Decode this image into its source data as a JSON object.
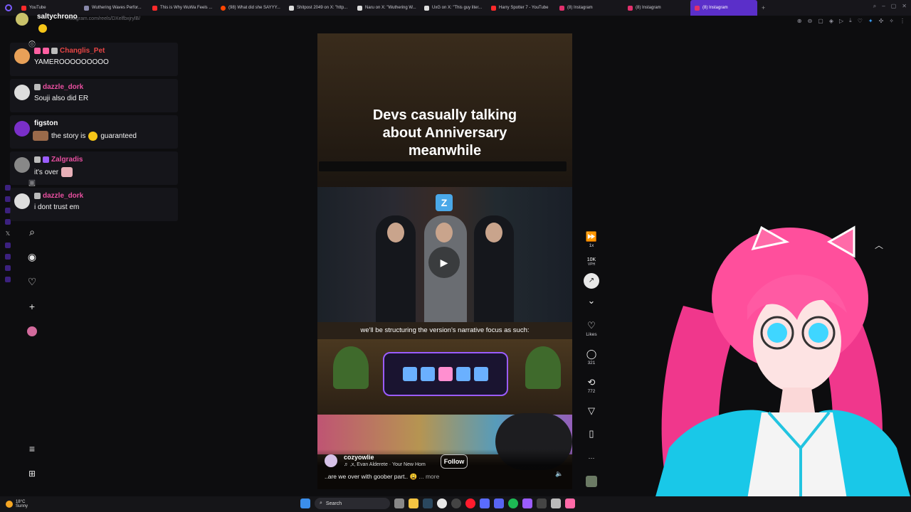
{
  "browser": {
    "tabs": [
      {
        "label": "YouTube",
        "color": "#ff2a2a",
        "active": false
      },
      {
        "label": "Wuthering Waves Perfor...",
        "color": "#8888aa",
        "active": false
      },
      {
        "label": "This is Why WuWa Feels ...",
        "color": "#ff2a2a",
        "active": false
      },
      {
        "label": "(98) What did she SAYYY...",
        "color": "#ff4500",
        "active": false
      },
      {
        "label": "Shitpost 2049 on X: \"http...",
        "color": "#dddddd",
        "active": false
      },
      {
        "label": "Naru on X: \"Wuthering W...",
        "color": "#dddddd",
        "active": false
      },
      {
        "label": "UxG on X: \"This guy liter...",
        "color": "#dddddd",
        "active": false
      },
      {
        "label": "Harry Spotter 7 - YouTube",
        "color": "#ff2a2a",
        "active": false
      },
      {
        "label": "(8) Instagram",
        "color": "#e1306c",
        "active": false
      },
      {
        "label": "(8) Instagram",
        "color": "#e1306c",
        "active": false
      },
      {
        "label": "(8) Instagram",
        "color": "#e1306c",
        "active": true
      }
    ],
    "new_tab": "+",
    "url": "instagram.com/reels/DXelfbxjrylB/"
  },
  "chat": [
    {
      "user": "saltychrono",
      "user_color": "#ffffff",
      "text": "",
      "avatar_color": "#c9c26a",
      "emote_color": "#f5c518",
      "badges": []
    },
    {
      "user": "Changlis_Pet",
      "user_color": "#e84545",
      "text": "YAMEROOOOOOOOO",
      "avatar_color": "#e8a058",
      "badges": [
        "#ff5fa2",
        "#ff5fa2",
        "#bbbbbb"
      ]
    },
    {
      "user": "dazzle_dork",
      "user_color": "#e84fa0",
      "text": "Souji also did ER",
      "avatar_color": "#dddddd",
      "badges": [
        "#bbbbbb"
      ]
    },
    {
      "user": "figston",
      "user_color": "#ffffff",
      "text_before": "the story is",
      "text_after": "guaranteed",
      "avatar_color": "#7a2fc9",
      "badges": []
    },
    {
      "user": "Zalgradis",
      "user_color": "#e84fa0",
      "text": "it's over",
      "avatar_color": "#888888",
      "badges": [
        "#bbbbbb",
        "#9b5cff"
      ]
    },
    {
      "user": "dazzle_dork",
      "user_color": "#e84fa0",
      "text": "i dont trust em",
      "avatar_color": "#dddddd",
      "badges": [
        "#bbbbbb"
      ]
    }
  ],
  "reel": {
    "title_lines": [
      "Devs casually talking",
      "about Anniversary",
      "meanwhile"
    ],
    "subtitle": "we'll be structuring the version's narrative focus as such:",
    "logo_letter": "Z",
    "username": "cozyowlie",
    "music": "♬ ,x, Evan Alderete · Your New Hom",
    "follow": "Follow",
    "caption": "..are we over with goober part.. 😩",
    "caption_more": "... more"
  },
  "actions": {
    "speed": "1x",
    "vph_value": "10K",
    "vph_label": "VPH",
    "likes_label": "Likes",
    "comments": "321",
    "reposts": "772",
    "more": "···"
  },
  "taskbar": {
    "temp": "18°C",
    "condition": "Sunny",
    "search": "Search"
  }
}
